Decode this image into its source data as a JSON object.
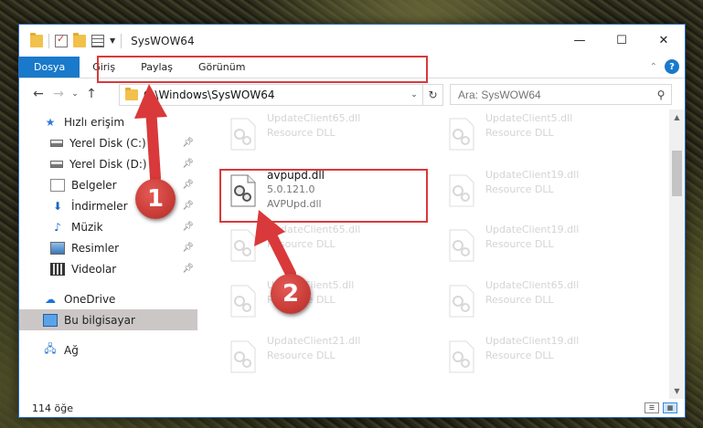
{
  "window": {
    "title": "SysWOW64",
    "controls": {
      "minimize": "—",
      "maximize": "☐",
      "close": "✕"
    }
  },
  "ribbon": {
    "tabs": [
      "Dosya",
      "Giriş",
      "Paylaş",
      "Görünüm"
    ],
    "help": "?"
  },
  "address": {
    "path": "C:\\Windows\\SysWOW64",
    "search_placeholder": "Ara: SysWOW64"
  },
  "sidebar": {
    "quick_access": "Hızlı erişim",
    "items": [
      {
        "label": "Yerel Disk (C:)",
        "icon": "disk-icon"
      },
      {
        "label": "Yerel Disk (D:)",
        "icon": "disk-icon"
      },
      {
        "label": "Belgeler",
        "icon": "documents-icon"
      },
      {
        "label": "İndirmeler",
        "icon": "downloads-icon"
      },
      {
        "label": "Müzik",
        "icon": "music-icon"
      },
      {
        "label": "Resimler",
        "icon": "pictures-icon"
      },
      {
        "label": "Videolar",
        "icon": "videos-icon"
      }
    ],
    "onedrive": "OneDrive",
    "this_pc": "Bu bilgisayar",
    "network": "Ağ"
  },
  "files": {
    "highlighted": {
      "name": "avpupd.dll",
      "version": "5.0.121.0",
      "description": "AVPUpd.dll"
    },
    "background": [
      {
        "name": "UpdateClient65.dll",
        "type": "Resource DLL"
      },
      {
        "name": "UpdateClient5.dll",
        "type": "Resource DLL"
      },
      {
        "name": "UpdateClient19.dll",
        "type": "Resource DLL"
      },
      {
        "name": "UpdateClient65.dll",
        "type": "Resource DLL"
      },
      {
        "name": "UpdateClient19.dll",
        "type": "Resource DLL"
      },
      {
        "name": "UpdateClient5.dll",
        "type": "Resource DLL"
      },
      {
        "name": "UpdateClient65.dll",
        "type": "Resource DLL"
      },
      {
        "name": "UpdateClient21.dll",
        "type": "Resource DLL"
      },
      {
        "name": "UpdateClient19.dll",
        "type": "Resource DLL"
      }
    ]
  },
  "status": {
    "count": "114 öğe"
  },
  "annotations": {
    "step1": "1",
    "step2": "2",
    "color": "#d9393a"
  }
}
